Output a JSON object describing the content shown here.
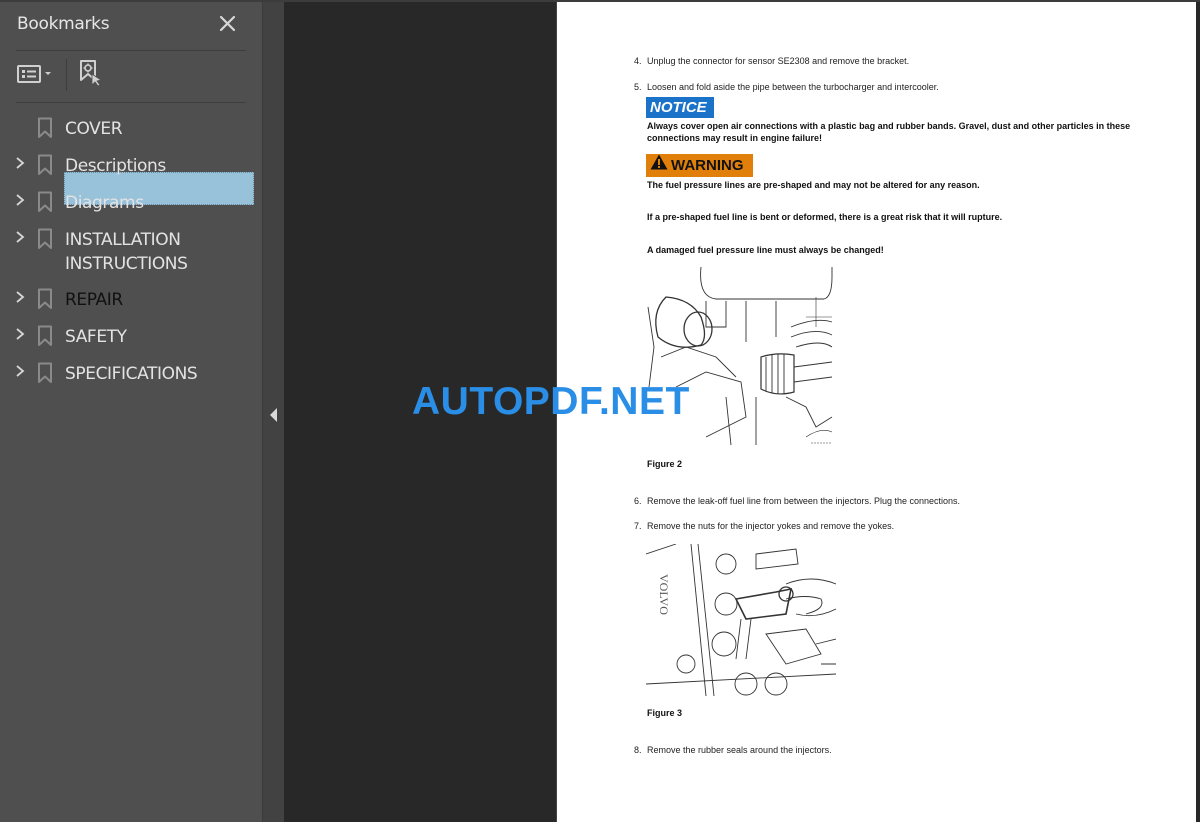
{
  "sidebar": {
    "title": "Bookmarks",
    "toolbar": {
      "options_icon": "list-options-icon",
      "find_bookmark_icon": "find-current-bookmark-icon"
    },
    "items": [
      {
        "label": "COVER",
        "expandable": false,
        "selected": false
      },
      {
        "label": "Descriptions",
        "expandable": true,
        "selected": false
      },
      {
        "label": "Diagrams",
        "expandable": true,
        "selected": false
      },
      {
        "label": "INSTALLATION INSTRUCTIONS",
        "line1": "INSTALLATION",
        "line2": "INSTRUCTIONS",
        "expandable": true,
        "selected": false
      },
      {
        "label": "REPAIR",
        "expandable": true,
        "selected": true
      },
      {
        "label": "SAFETY",
        "expandable": true,
        "selected": false
      },
      {
        "label": "SPECIFICATIONS",
        "expandable": true,
        "selected": false
      }
    ]
  },
  "document": {
    "steps": [
      {
        "num": "4.",
        "text": "Unplug the connector for sensor SE2308 and remove the bracket."
      },
      {
        "num": "5.",
        "text": "Loosen and fold aside the pipe between the turbocharger and intercooler."
      },
      {
        "num": "6.",
        "text": "Remove the leak-off fuel line from between the injectors. Plug the connections."
      },
      {
        "num": "7.",
        "text": "Remove the nuts for the injector yokes and remove the yokes."
      },
      {
        "num": "8.",
        "text": "Remove the rubber seals around the injectors."
      }
    ],
    "notice": {
      "label": "NOTICE",
      "line1": "Always cover open air connections with a plastic bag and rubber bands. Gravel, dust and other particles in these",
      "line2": "connections may result in engine failure!"
    },
    "warning": {
      "label": "WARNING",
      "lines": [
        "The fuel pressure lines are pre-shaped and may not be altered for any reason.",
        "If a pre-shaped fuel line is bent or deformed, there is a great risk that it will rupture.",
        "A damaged fuel pressure line must always be changed!"
      ]
    },
    "figures": [
      {
        "caption": "Figure 2"
      },
      {
        "caption": "Figure 3",
        "embossed_text": "VOLVO"
      }
    ]
  },
  "watermark": "AUTOPDF.NET",
  "colors": {
    "sidebar_bg": "#4f4f4f",
    "doc_bg": "#282828",
    "selection": "#98c1da",
    "notice": "#1a73c8",
    "warning": "#e0800b",
    "watermark": "#2a8ee6"
  }
}
